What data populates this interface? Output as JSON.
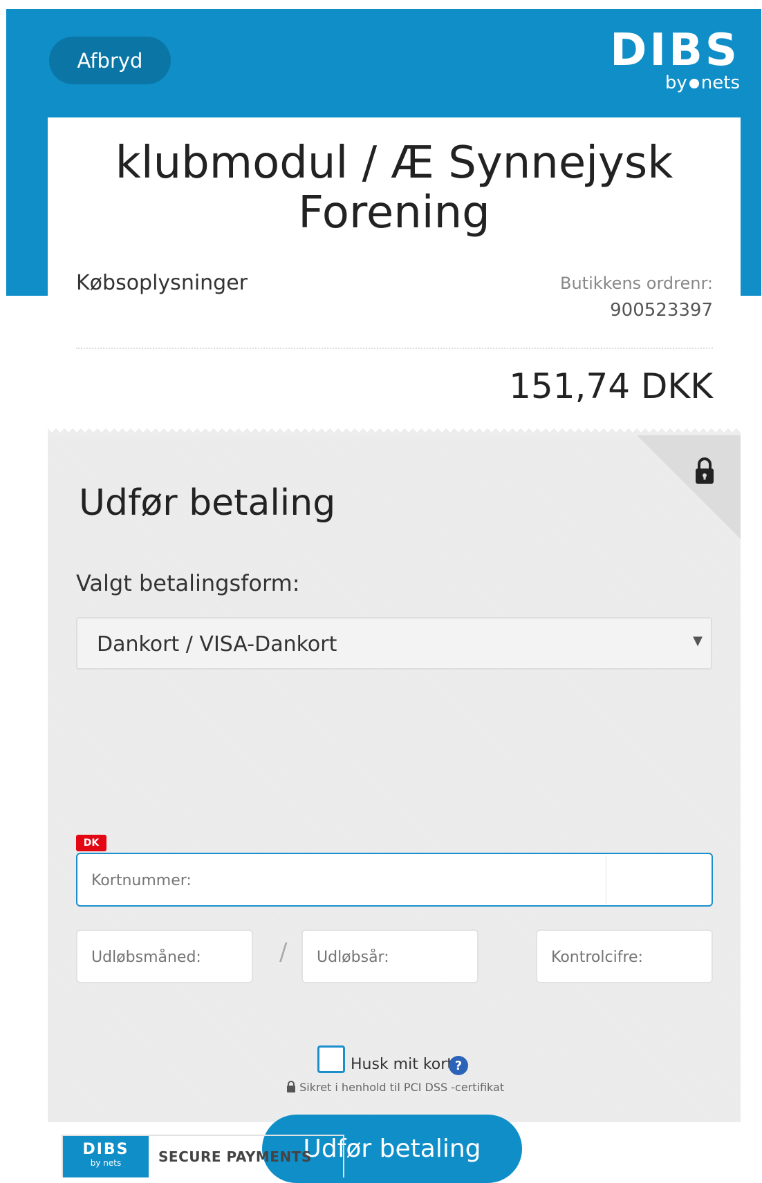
{
  "header": {
    "cancel_label": "Afbryd",
    "logo_text": "DIBS",
    "logo_sub_by": "by",
    "logo_sub_nets": "nets"
  },
  "order": {
    "merchant_title": "klubmodul / Æ Synnejysk Forening",
    "purchase_info_label": "Købsoplysninger",
    "order_number_label": "Butikkens ordrenr:",
    "order_number": "900523397",
    "amount": "151,74 DKK"
  },
  "payment": {
    "title": "Udfør betaling",
    "method_label": "Valgt betalingsform:",
    "method_selected": "Dankort / VISA-Dankort",
    "card_badge": "DK",
    "card_number_placeholder": "Kortnummer:",
    "expiry_month_placeholder": "Udløbsmåned:",
    "expiry_separator": "/",
    "expiry_year_placeholder": "Udløbsår:",
    "cvc_placeholder": "Kontrolcifre:",
    "remember_card_label": "Husk mit kort",
    "help_glyph": "?",
    "security_note": "Sikret i henhold til PCI DSS -certifikat",
    "submit_label": "Udfør betaling"
  },
  "footer": {
    "badge_logo": "DIBS",
    "badge_logo_sub": "by nets",
    "badge_text": "SECURE PAYMENTS"
  },
  "colors": {
    "brand_blue": "#0f8ec8",
    "cancel_button": "#0b76a6",
    "panel_gray": "#ededed",
    "field_focus": "#1b8fcc",
    "dankort_red": "#e30613"
  }
}
